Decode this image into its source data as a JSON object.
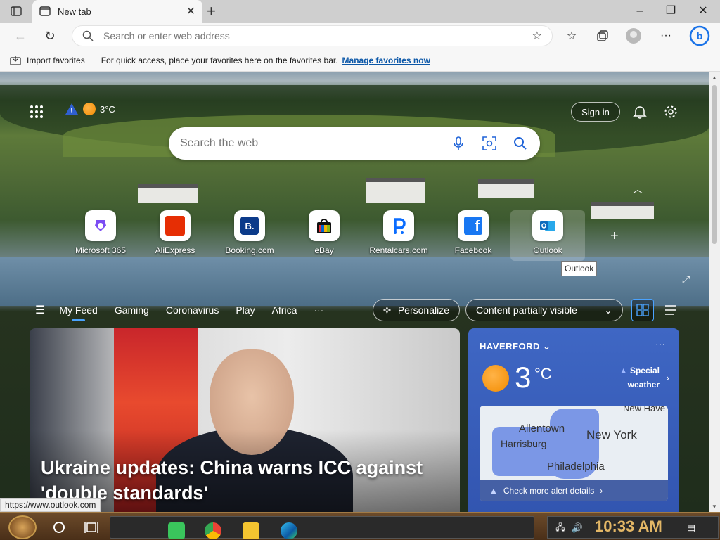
{
  "browser": {
    "tab_title": "New tab",
    "address_placeholder": "Search or enter web address"
  },
  "favorites_bar": {
    "import_label": "Import favorites",
    "hint": "For quick access, place your favorites here on the favorites bar.",
    "manage_link": "Manage favorites now"
  },
  "top": {
    "temperature": "3°C",
    "sign_in": "Sign in",
    "search_placeholder": "Search the web"
  },
  "quick_links": [
    {
      "label": "Microsoft 365",
      "icon": "m365-icon"
    },
    {
      "label": "AliExpress",
      "icon": "aliexpress-icon"
    },
    {
      "label": "Booking.com",
      "icon": "booking-icon"
    },
    {
      "label": "eBay",
      "icon": "ebay-icon"
    },
    {
      "label": "Rentalcars.com",
      "icon": "rentalcars-icon"
    },
    {
      "label": "Facebook",
      "icon": "facebook-icon"
    },
    {
      "label": "Outlook",
      "icon": "outlook-icon"
    }
  ],
  "tooltip": "Outlook",
  "feed_nav": {
    "items": [
      "My Feed",
      "Gaming",
      "Coronavirus",
      "Play",
      "Africa"
    ],
    "more": "···",
    "personalize": "Personalize",
    "content_visibility": "Content partially visible"
  },
  "news": {
    "headline": "Ukraine updates: China warns ICC against 'double standards'"
  },
  "weather": {
    "location": "HAVERFORD",
    "temp": "3",
    "unit": "°C",
    "alert_line1": "Special",
    "alert_line2": "weather",
    "map_cities": [
      "New Have",
      "Allentown",
      "New York",
      "Harrisburg",
      "Philadelphia"
    ],
    "map_footer": "Check more alert details"
  },
  "status_url": "https://www.outlook.com",
  "taskbar": {
    "clock": "10:33 AM"
  },
  "colors": {
    "accent": "#0b57a8",
    "weather_card": "#3f67c4",
    "feed_underline": "#4aa3ff"
  }
}
